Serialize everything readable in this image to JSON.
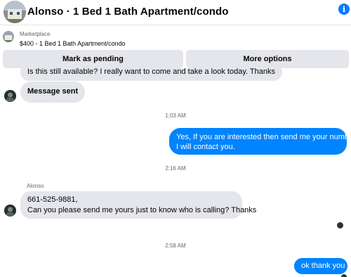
{
  "header": {
    "title": "Alonso · 1 Bed 1 Bath Apartment/condo",
    "avatar_icon": "house-thumbnail",
    "info_icon": "info-icon"
  },
  "listing": {
    "source": "Marketplace",
    "title": "$400 - 1 Bed 1 Bath Apartment/condo"
  },
  "actions": {
    "mark_pending": "Mark as pending",
    "more_options": "More options"
  },
  "thread": {
    "partial_message": "Is this still available? I really want to come and take a look today. Thanks",
    "message_sent": "Message sent",
    "time_1": "1:03 AM",
    "outgoing_1_line1": "Yes, If you are interested then send me your number",
    "outgoing_1_line2": "I will contact you.",
    "time_2": "2:16 AM",
    "sender_name": "Alonso",
    "incoming_line1": "661-525-9881,",
    "incoming_line2": "Can you please send me yours just to know who is calling? Thanks",
    "time_3": "2:58 AM",
    "outgoing_2": "ok thank you"
  },
  "colors": {
    "outgoing_bubble": "#0084ff",
    "incoming_bubble": "#e4e6eb",
    "accent": "#0a7cff"
  }
}
